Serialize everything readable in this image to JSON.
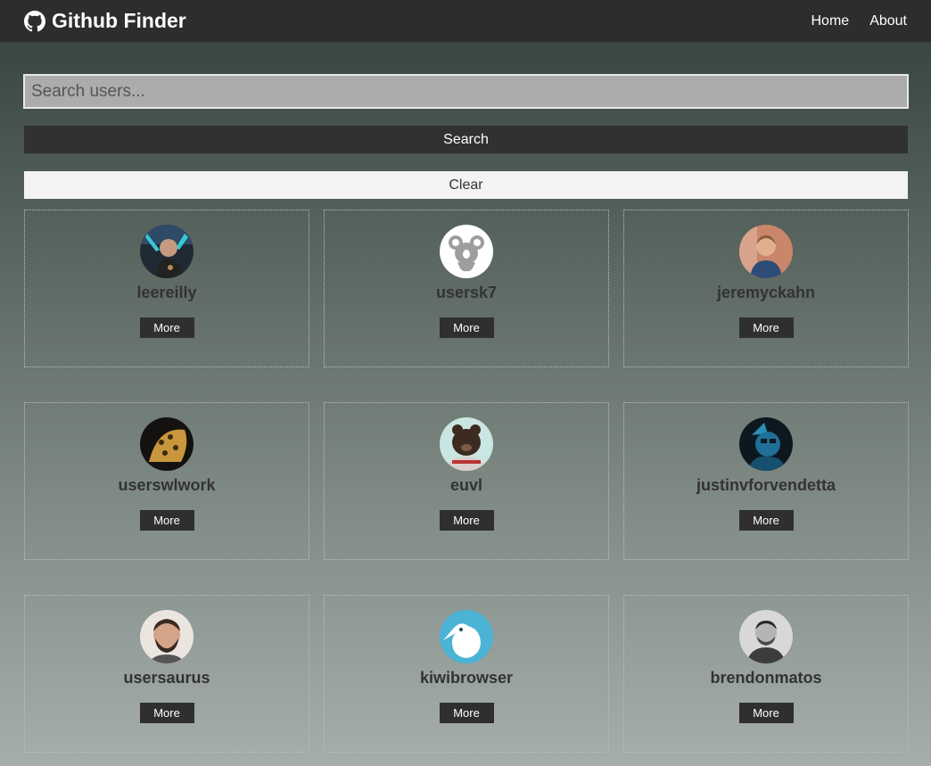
{
  "navbar": {
    "brand": "Github Finder",
    "links": [
      "Home",
      "About"
    ]
  },
  "search": {
    "placeholder": "Search users...",
    "value": "",
    "search_label": "Search",
    "clear_label": "Clear"
  },
  "users": [
    {
      "login": "leereilly",
      "more_label": "More"
    },
    {
      "login": "usersk7",
      "more_label": "More"
    },
    {
      "login": "jeremyckahn",
      "more_label": "More"
    },
    {
      "login": "userswlwork",
      "more_label": "More"
    },
    {
      "login": "euvl",
      "more_label": "More"
    },
    {
      "login": "justinvforvendetta",
      "more_label": "More"
    },
    {
      "login": "usersaurus",
      "more_label": "More"
    },
    {
      "login": "kiwibrowser",
      "more_label": "More"
    },
    {
      "login": "brendonmatos",
      "more_label": "More"
    }
  ],
  "colors": {
    "navbar": "#2b2d2e",
    "button_dark": "#313131",
    "button_light": "#f3f3f3",
    "text_dark": "#333333"
  }
}
